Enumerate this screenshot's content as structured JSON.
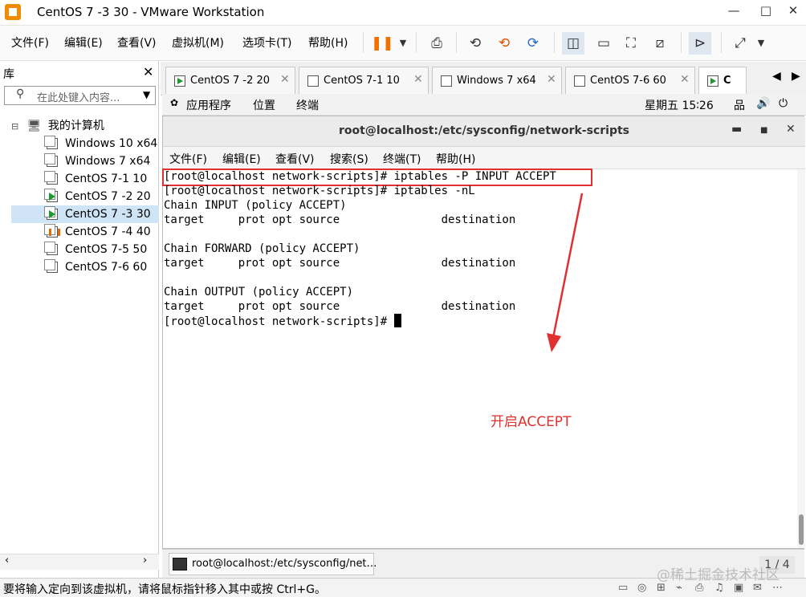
{
  "window": {
    "title": "CentOS 7 -3 30 - VMware Workstation",
    "min": "—",
    "max": "□",
    "close": "✕"
  },
  "menu": [
    "文件(F)",
    "编辑(E)",
    "查看(V)",
    "虚拟机(M)",
    "选项卡(T)",
    "帮助(H)"
  ],
  "library": {
    "title": "库",
    "close": "✕",
    "search_placeholder": "在此处键入内容...",
    "root": "我的计算机",
    "vms": [
      {
        "name": "Windows 10 x64",
        "state": "off"
      },
      {
        "name": "Windows 7 x64",
        "state": "off"
      },
      {
        "name": "CentOS 7-1  10",
        "state": "off"
      },
      {
        "name": "CentOS 7 -2 20",
        "state": "running"
      },
      {
        "name": "CentOS 7 -3 30",
        "state": "running"
      },
      {
        "name": "CentOS 7 -4 40",
        "state": "paused"
      },
      {
        "name": "CentOS 7-5 50",
        "state": "off"
      },
      {
        "name": "CentOS 7-6  60",
        "state": "off"
      }
    ]
  },
  "tabs": [
    "CentOS 7 -2 20",
    "CentOS 7-1  10",
    "Windows 7 x64",
    "CentOS 7-6  60",
    "C"
  ],
  "guest": {
    "apps": "应用程序",
    "places": "位置",
    "terminal": "终端",
    "clock": "星期五 15∶26"
  },
  "terminal": {
    "title": "root@localhost:/etc/sysconfig/network-scripts",
    "menu": [
      "文件(F)",
      "编辑(E)",
      "查看(V)",
      "搜索(S)",
      "终端(T)",
      "帮助(H)"
    ],
    "lines": [
      "[root@localhost network-scripts]# iptables -P INPUT ACCEPT",
      "[root@localhost network-scripts]# iptables -nL",
      "Chain INPUT (policy ACCEPT)",
      "target     prot opt source               destination",
      "",
      "Chain FORWARD (policy ACCEPT)",
      "target     prot opt source               destination",
      "",
      "Chain OUTPUT (policy ACCEPT)",
      "target     prot opt source               destination",
      "[root@localhost network-scripts]# "
    ],
    "annotation": "开启ACCEPT"
  },
  "taskbar": {
    "item": "root@localhost:/etc/sysconfig/net…",
    "pager": "1 / 4"
  },
  "status": {
    "text": "要将输入定向到该虚拟机，请将鼠标指针移入其中或按 Ctrl+G。"
  },
  "watermark": "@稀土掘金技术社区"
}
